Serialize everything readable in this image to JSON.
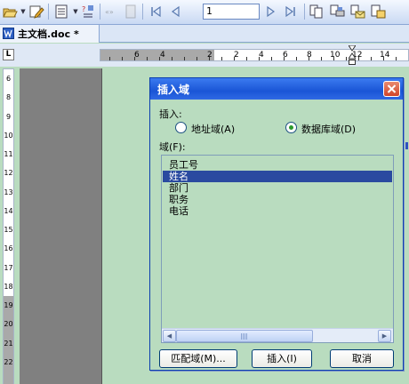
{
  "toolbar": {
    "record_value": "1",
    "icons": [
      "open-folder-icon",
      "edit-pen-icon",
      "document-icon",
      "merge-field-icon",
      "abc-icon",
      "page-icon",
      "first-record-icon",
      "prev-record-icon",
      "next-record-icon",
      "last-record-icon",
      "merge-doc-icon",
      "merge-printer-icon",
      "merge-email-icon",
      "find-record-icon"
    ]
  },
  "tab": {
    "title": "主文档.doc *"
  },
  "h_ruler": {
    "numbers": [
      "6",
      "4",
      "2",
      "2",
      "4",
      "6",
      "8",
      "10",
      "12",
      "14"
    ]
  },
  "v_ruler": {
    "numbers": [
      "6",
      "8",
      "9",
      "10",
      "11",
      "12",
      "13",
      "14",
      "15",
      "16",
      "17",
      "18",
      "19",
      "20",
      "21",
      "22"
    ]
  },
  "dialog": {
    "title": "插入域",
    "insert_label": "插入:",
    "radio_address": "地址域(A)",
    "radio_database": "数据库域(D)",
    "field_label": "域(F):",
    "fields": [
      "员工号",
      "姓名",
      "部门",
      "职务",
      "电话"
    ],
    "selected_field": "姓名",
    "buttons": {
      "match": "匹配域(M)...",
      "insert": "插入(I)",
      "cancel": "取消"
    }
  },
  "colors": {
    "background": "#b9dcbf",
    "title_bar": "#1a55d6",
    "selection": "#2a4aa0"
  }
}
